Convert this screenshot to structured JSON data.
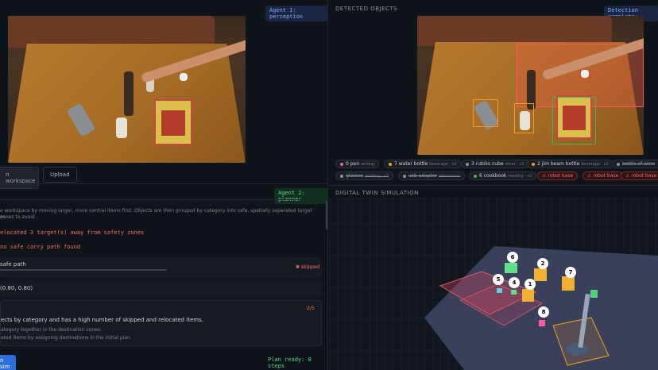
{
  "left": {
    "agent1_tag": "Agent 1: perception",
    "buttons": {
      "workspace": "n workspace",
      "upload": "Upload",
      "sim": "n sim"
    },
    "agent2_tag": "Agent 2: planner",
    "intro": "e workspace by moving larger, more central items first. Objects are then grouped by category into safe, spatially separated target zones to avoid",
    "intro2": "es.",
    "warn1": "elocated 3 target(s) away from safety zones",
    "warn2": "no safe carry path found",
    "step_title": "safe path",
    "step_badge": "skipped",
    "step_sub": "(0.80, 0.80)",
    "summary_count": "2/5",
    "summary_title": "ects by category and has a high number of skipped and relocated items.",
    "summary_line1": "ategory together in the destination zones.",
    "summary_line2": "ated items by assigning destinations in the initial plan.",
    "plan_ready": "Plan ready: 8 steps"
  },
  "right": {
    "detected_title": "DETECTED OBJECTS",
    "detection_tag": "Detection complete:",
    "chips_row1": [
      {
        "num": "0",
        "label": "pen",
        "sub": "writing",
        "color": "#ff5aa0"
      },
      {
        "num": "7",
        "label": "water bottle",
        "sub": "beverage · x2",
        "color": "#f0a020"
      },
      {
        "num": "3",
        "label": "rubiks cube",
        "sub": "other · x2",
        "color": "#8b949e"
      },
      {
        "num": "2",
        "label": "jim beam bottle",
        "sub": "beverage · x2",
        "color": "#f0a020"
      },
      {
        "num": "",
        "label": "bottle of wine",
        "sub": "",
        "color": "#8b949e"
      }
    ],
    "chips_row2": [
      {
        "num": "",
        "label": "glasses",
        "sub": "reading · x2",
        "color": "#8b949e"
      },
      {
        "num": "",
        "label": "usb adapter",
        "sub": "electronics",
        "color": "#8b949e"
      },
      {
        "num": "6",
        "label": "cookbook",
        "sub": "reading · x2",
        "color": "#3fb950"
      }
    ],
    "robot_chips": [
      "robot base",
      "robot base",
      "robot base"
    ],
    "sim_title": "DIGITAL TWIN SIMULATION",
    "markers": [
      "6",
      "2",
      "7",
      "5",
      "4",
      "1",
      "8"
    ]
  }
}
